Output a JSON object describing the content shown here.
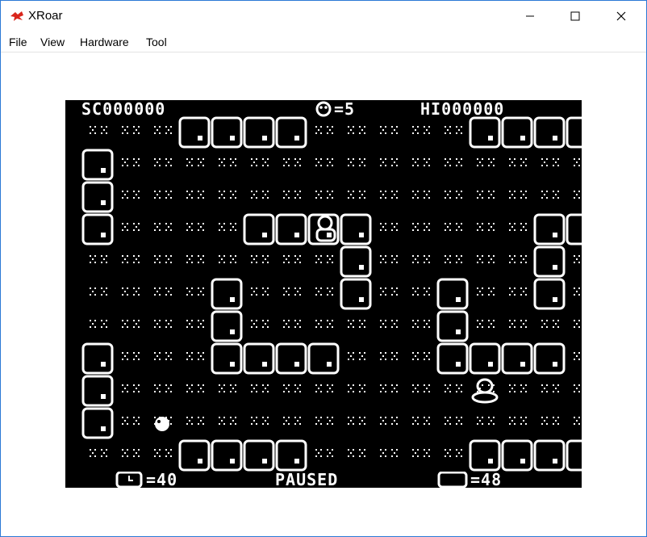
{
  "window": {
    "title": "XRoar"
  },
  "menu": {
    "items": [
      "File",
      "View",
      "Hardware",
      "Tool"
    ]
  },
  "game": {
    "score": "SC000000",
    "lives": "=5",
    "hiscore": "HI000000",
    "timer": "=40",
    "status": "PAUSED",
    "blocks": "=48"
  },
  "colors": {
    "screen": "#000000",
    "sprite": "#ffffff",
    "window_border": "#2b79d6"
  }
}
